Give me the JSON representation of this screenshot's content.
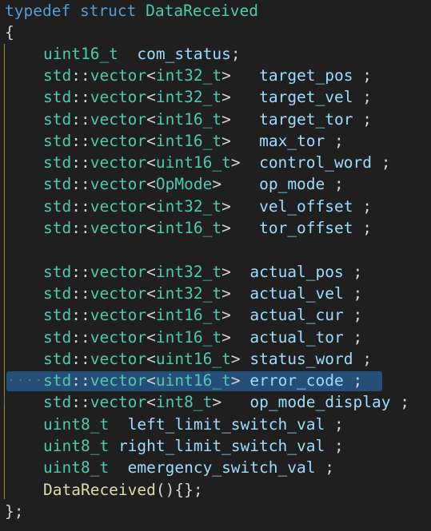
{
  "header": {
    "typedef_kw": "typedef",
    "struct_kw": "struct",
    "struct_name": "DataReceived",
    "open_brace": "{"
  },
  "fields": [
    {
      "type": "uint16_t",
      "name": "com_status",
      "end": ";"
    },
    {
      "ns": "std",
      "sep": "::",
      "tmpl": "vector",
      "lt": "<",
      "arg": "int32_t",
      "gt": ">",
      "name": "target_pos",
      "end": ";"
    },
    {
      "ns": "std",
      "sep": "::",
      "tmpl": "vector",
      "lt": "<",
      "arg": "int32_t",
      "gt": ">",
      "name": "target_vel",
      "end": ";"
    },
    {
      "ns": "std",
      "sep": "::",
      "tmpl": "vector",
      "lt": "<",
      "arg": "int16_t",
      "gt": ">",
      "name": "target_tor",
      "end": ";"
    },
    {
      "ns": "std",
      "sep": "::",
      "tmpl": "vector",
      "lt": "<",
      "arg": "int16_t",
      "gt": ">",
      "name": "max_tor",
      "end": ";"
    },
    {
      "ns": "std",
      "sep": "::",
      "tmpl": "vector",
      "lt": "<",
      "arg": "uint16_t",
      "gt": ">",
      "name": "control_word",
      "end": ";"
    },
    {
      "ns": "std",
      "sep": "::",
      "tmpl": "vector",
      "lt": "<",
      "arg": "OpMode",
      "gt": ">",
      "name": "op_mode",
      "end": ";"
    },
    {
      "ns": "std",
      "sep": "::",
      "tmpl": "vector",
      "lt": "<",
      "arg": "int32_t",
      "gt": ">",
      "name": "vel_offset",
      "end": ";"
    },
    {
      "ns": "std",
      "sep": "::",
      "tmpl": "vector",
      "lt": "<",
      "arg": "int16_t",
      "gt": ">",
      "name": "tor_offset",
      "end": ";"
    },
    {
      "ns": "std",
      "sep": "::",
      "tmpl": "vector",
      "lt": "<",
      "arg": "int32_t",
      "gt": ">",
      "name": "actual_pos",
      "end": ";"
    },
    {
      "ns": "std",
      "sep": "::",
      "tmpl": "vector",
      "lt": "<",
      "arg": "int32_t",
      "gt": ">",
      "name": "actual_vel",
      "end": ";"
    },
    {
      "ns": "std",
      "sep": "::",
      "tmpl": "vector",
      "lt": "<",
      "arg": "int16_t",
      "gt": ">",
      "name": "actual_cur",
      "end": ";"
    },
    {
      "ns": "std",
      "sep": "::",
      "tmpl": "vector",
      "lt": "<",
      "arg": "int16_t",
      "gt": ">",
      "name": "actual_tor",
      "end": ";"
    },
    {
      "ns": "std",
      "sep": "::",
      "tmpl": "vector",
      "lt": "<",
      "arg": "uint16_t",
      "gt": ">",
      "name": "status_word",
      "end": ";"
    },
    {
      "ns": "std",
      "sep": "::",
      "tmpl": "vector",
      "lt": "<",
      "arg": "uint16_t",
      "gt": ">",
      "name": "error_code",
      "end": ";"
    },
    {
      "ns": "std",
      "sep": "::",
      "tmpl": "vector",
      "lt": "<",
      "arg": "int8_t",
      "gt": ">",
      "name": "op_mode_display",
      "end": ";"
    },
    {
      "type": "uint8_t",
      "name": "left_limit_switch_val",
      "end": ";"
    },
    {
      "type": "uint8_t",
      "name": "right_limit_switch_val",
      "end": ";"
    },
    {
      "type": "uint8_t",
      "name": "emergency_switch_val",
      "end": ";"
    }
  ],
  "constructor": {
    "name": "DataReceived",
    "rest": "(){};"
  },
  "footer": {
    "close": "};"
  },
  "selection": {
    "dots": "····"
  },
  "colors": {
    "background": "#1f1f1f",
    "keyword": "#569cd6",
    "type": "#4ec9b0",
    "function": "#dcdcaa",
    "selection": "#264f78",
    "indent_guide": "#a08b2a"
  }
}
